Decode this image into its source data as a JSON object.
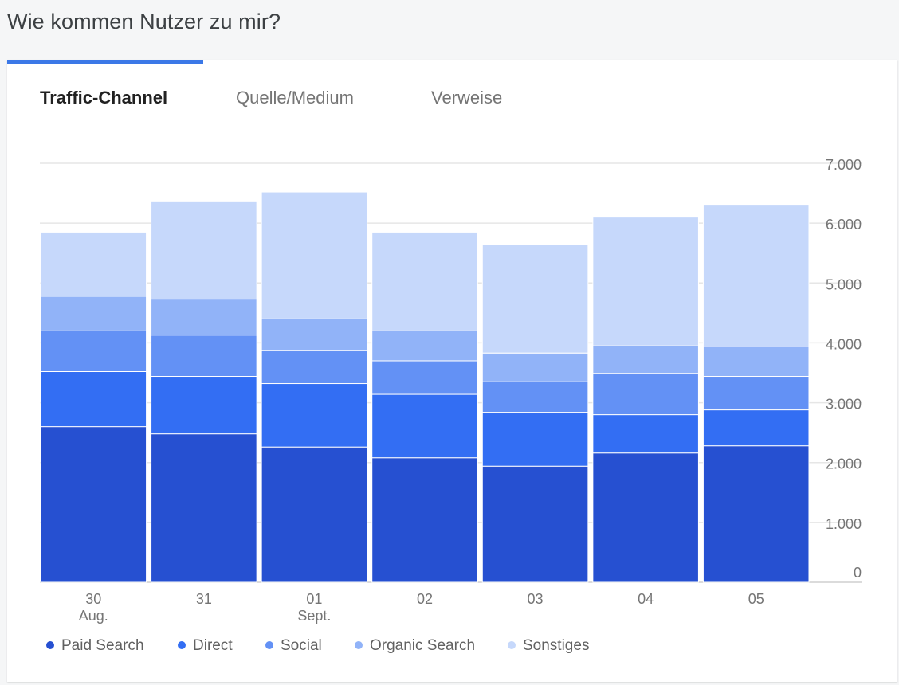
{
  "page": {
    "heading": "Wie kommen Nutzer zu mir?"
  },
  "tabs": [
    {
      "label": "Traffic-Channel",
      "active": true
    },
    {
      "label": "Quelle/Medium",
      "active": false
    },
    {
      "label": "Verweise",
      "active": false
    }
  ],
  "colors": {
    "accent": "#3b78e7",
    "gridline": "#e6e6e6",
    "axis_text": "#757575"
  },
  "chart_data": {
    "type": "bar",
    "stacked": true,
    "categories": [
      "30",
      "31",
      "01",
      "02",
      "03",
      "04",
      "05"
    ],
    "category_sublabels": [
      "Aug.",
      "",
      "Sept.",
      "",
      "",
      "",
      ""
    ],
    "ylim": [
      0,
      7000
    ],
    "y_ticks": [
      0,
      1000,
      2000,
      3000,
      4000,
      5000,
      6000,
      7000
    ],
    "y_tick_labels": [
      "0",
      "1.000",
      "2.000",
      "3.000",
      "4.000",
      "5.000",
      "6.000",
      "7.000"
    ],
    "y_axis_position": "right",
    "grid": true,
    "legend_position": "bottom-left",
    "series": [
      {
        "name": "Paid Search",
        "color": "#2650d1",
        "values": [
          2600,
          2480,
          2260,
          2080,
          1940,
          2160,
          2280
        ]
      },
      {
        "name": "Direct",
        "color": "#336ef3",
        "values": [
          920,
          960,
          1060,
          1060,
          900,
          640,
          600
        ]
      },
      {
        "name": "Social",
        "color": "#6391f5",
        "values": [
          680,
          690,
          550,
          560,
          510,
          690,
          560
        ]
      },
      {
        "name": "Organic Search",
        "color": "#91b3f8",
        "values": [
          580,
          600,
          530,
          500,
          480,
          460,
          500
        ]
      },
      {
        "name": "Sonstiges",
        "color": "#c6d8fb",
        "values": [
          1070,
          1640,
          2120,
          1650,
          1810,
          2150,
          2360
        ]
      }
    ]
  }
}
